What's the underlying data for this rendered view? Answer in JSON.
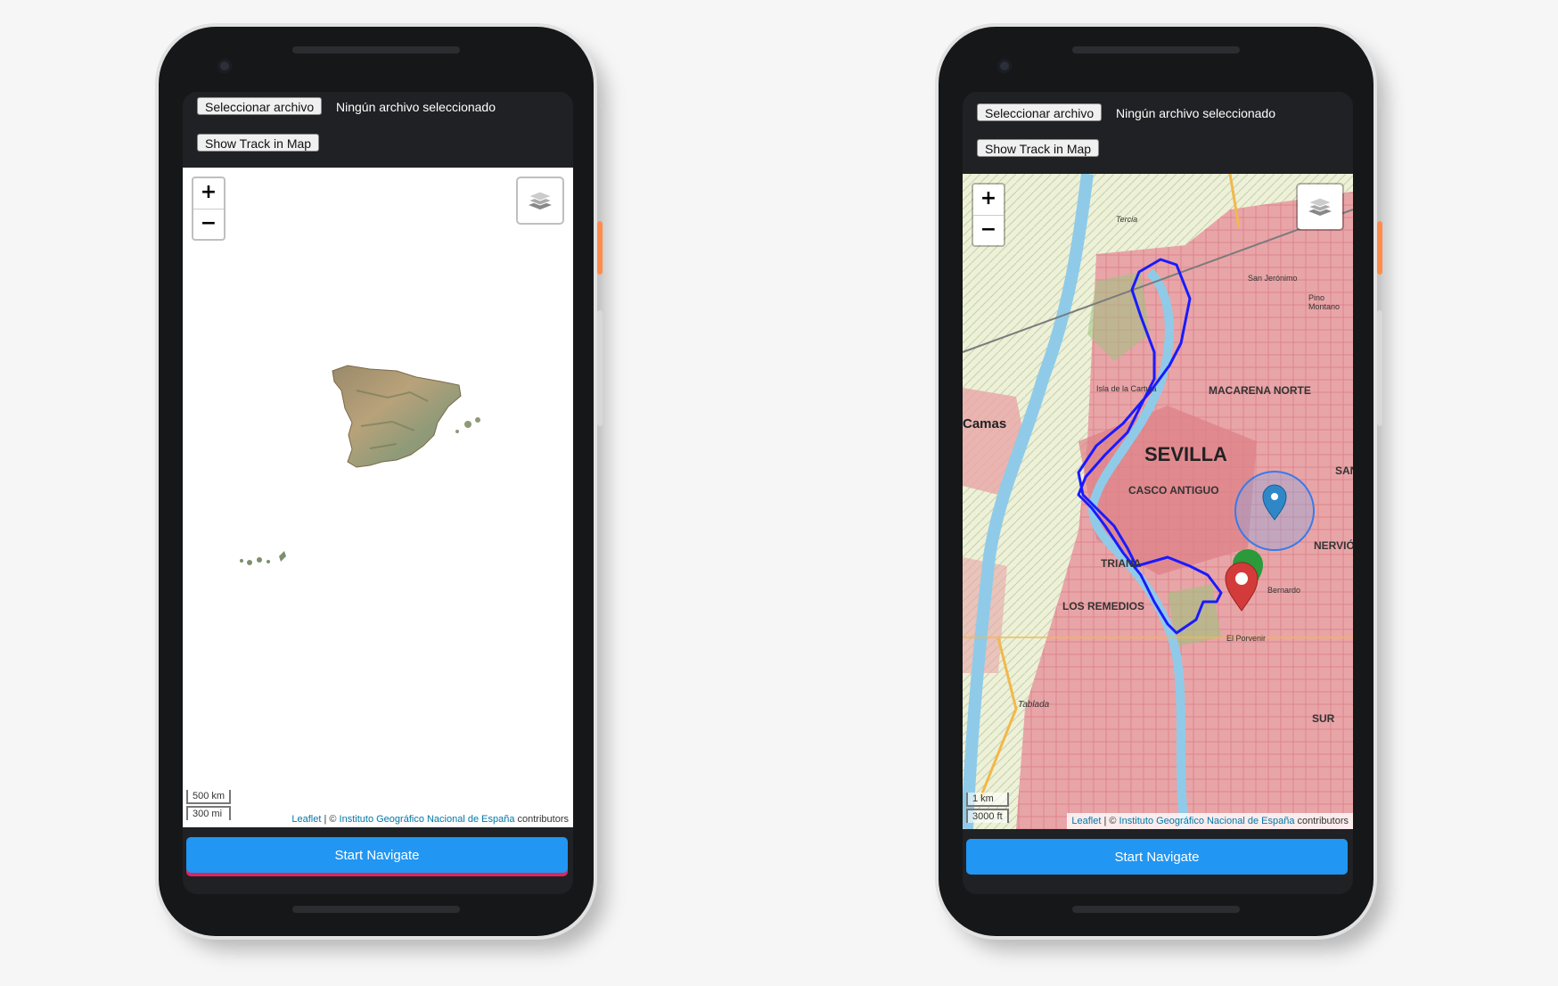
{
  "phones": {
    "left": {
      "file_button_label": "Seleccionar archivo",
      "file_status": "Ningún archivo seleccionado",
      "track_button_label": "Show Track in Map",
      "zoom_in_label": "+",
      "zoom_out_label": "−",
      "scale_metric": "500 km",
      "scale_imperial": "300 mi",
      "attribution_leaflet": "Leaflet",
      "attribution_sep": "| ©",
      "attribution_source": "Instituto Geográfico Nacional de España",
      "attribution_suffix": "contributors",
      "navigate_label": "Start Navigate"
    },
    "right": {
      "file_button_label": "Seleccionar archivo",
      "file_status": "Ningún archivo seleccionado",
      "track_button_label": "Show Track in Map",
      "zoom_in_label": "+",
      "zoom_out_label": "−",
      "scale_metric": "1 km",
      "scale_imperial": "3000 ft",
      "attribution_leaflet": "Leaflet",
      "attribution_sep": "| ©",
      "attribution_source": "Instituto Geográfico Nacional de España",
      "attribution_suffix": "contributors",
      "navigate_label": "Start Navigate",
      "map_labels": {
        "city": "SEVILLA",
        "macarena": "MACARENA NORTE",
        "casco": "CASCO ANTIGUO",
        "triana": "TRIANA",
        "remedios": "LOS REMEDIOS",
        "camas": "Camas",
        "nervion": "NERVIÓN",
        "sur": "SUR",
        "san": "SAN",
        "isla": "Isla de la Cartuja",
        "san_jeronimo": "San Jerónimo",
        "pino_montano": "Pino Montano",
        "san_bernardo": "Bernardo",
        "el_porvenir": "El Porvenir",
        "tablada": "Tablada",
        "tercia": "Tercia"
      }
    }
  },
  "colors": {
    "accent": "#2196f3",
    "track": "#1a1aff",
    "urban": "#e8a5a8",
    "link": "#0078a8"
  },
  "icons": {
    "layers": "layers-icon",
    "location": "location-marker-icon",
    "start": "start-marker-icon",
    "end": "end-marker-icon"
  }
}
